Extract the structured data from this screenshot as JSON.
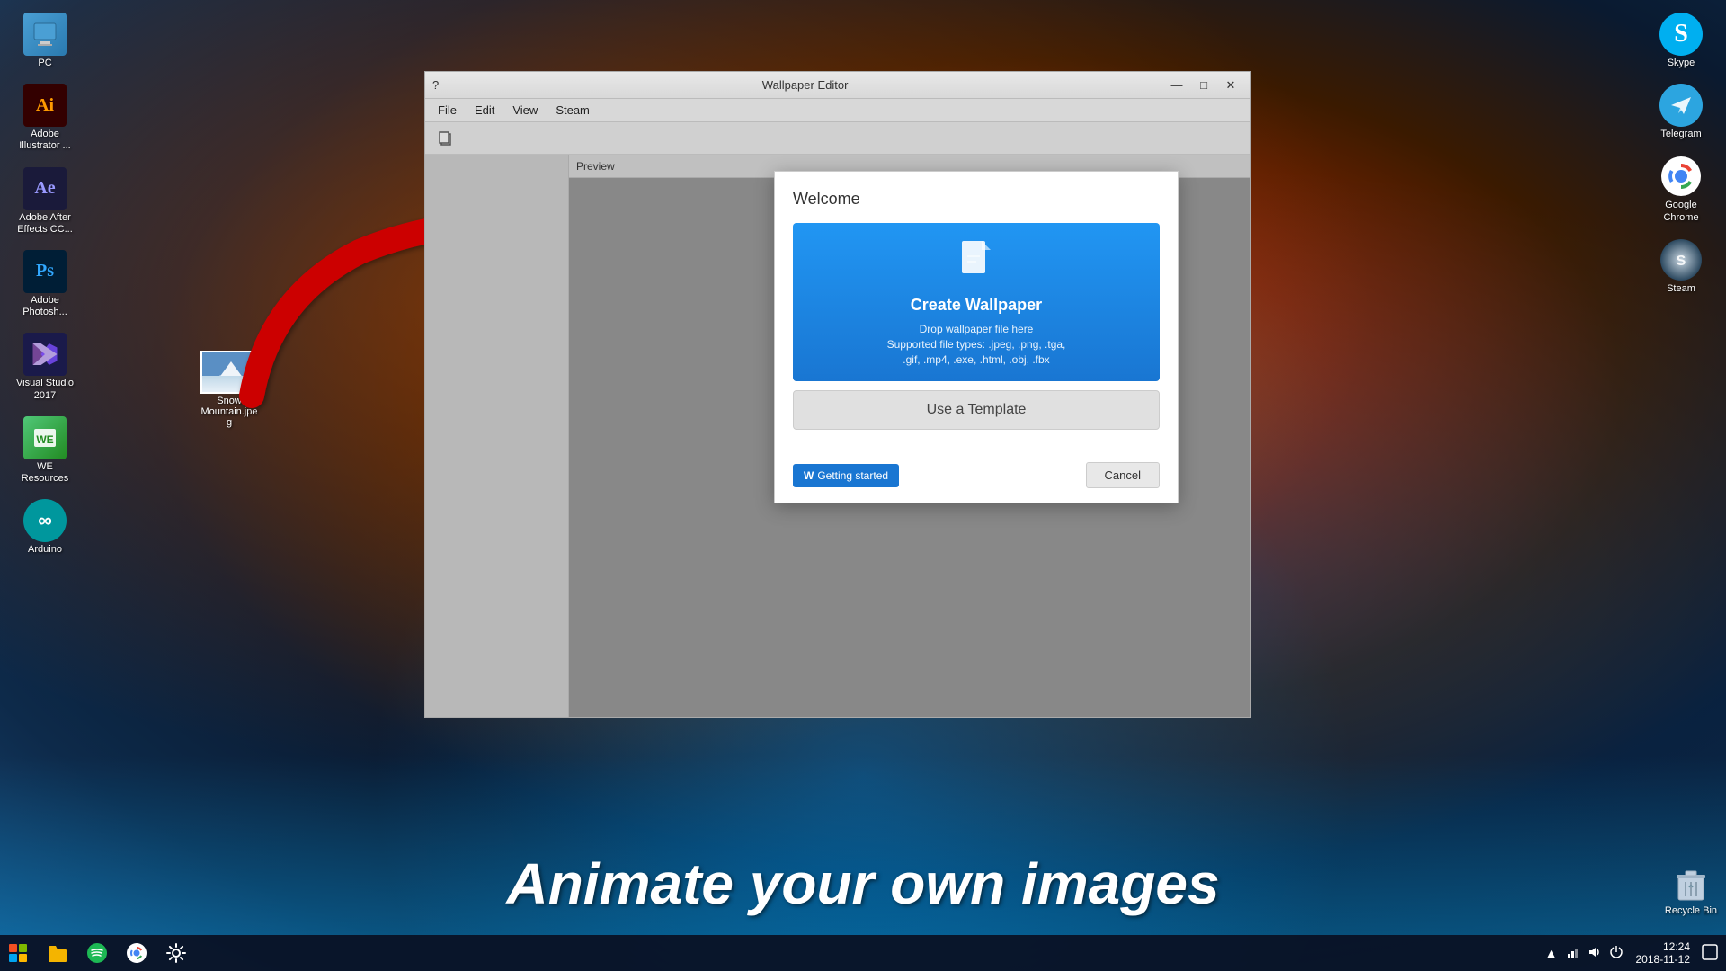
{
  "desktop": {
    "background_description": "space nebula with orange and blue colors"
  },
  "desktop_icons_left": {
    "items": [
      {
        "id": "pc",
        "label": "PC",
        "type": "pc"
      },
      {
        "id": "adobe_illustrator",
        "label": "Adobe Illustrator ...",
        "type": "ai"
      },
      {
        "id": "adobe_after_effects",
        "label": "Adobe After Effects CC...",
        "type": "ae"
      },
      {
        "id": "adobe_photoshop",
        "label": "Adobe Photosh...",
        "type": "ps"
      },
      {
        "id": "visual_studio",
        "label": "Visual Studio 2017",
        "type": "vs"
      },
      {
        "id": "we_resources",
        "label": "WE Resources",
        "type": "we"
      },
      {
        "id": "arduino",
        "label": "Arduino",
        "type": "arduino"
      }
    ]
  },
  "desktop_icons_right": {
    "items": [
      {
        "id": "skype",
        "label": "Skype",
        "type": "skype"
      },
      {
        "id": "telegram",
        "label": "Telegram",
        "type": "telegram"
      },
      {
        "id": "google_chrome",
        "label": "Google Chrome",
        "type": "chrome"
      },
      {
        "id": "steam",
        "label": "Steam",
        "type": "steam"
      }
    ]
  },
  "desktop_file": {
    "label": "Snow Mountain.jpeg",
    "short_label": "Snow\nMountain.jpe\ng"
  },
  "we_window": {
    "title": "Wallpaper Editor",
    "menu_items": [
      "File",
      "Edit",
      "View",
      "Steam"
    ],
    "preview_label": "Preview"
  },
  "welcome_dialog": {
    "title": "Welcome",
    "create_wallpaper": {
      "label": "Create Wallpaper",
      "drop_text": "Drop wallpaper file here\nSupported file types: .jpeg, .png, .tga,\n.gif, .mp4, .exe, .html, .obj, .fbx"
    },
    "use_template_label": "Use a Template",
    "getting_started_label": "Getting started",
    "cancel_label": "Cancel"
  },
  "bottom_overlay_text": "Animate your own images",
  "taskbar": {
    "start_label": "Start",
    "time": "12:24",
    "date": "2018-11-12"
  },
  "recycle_bin": {
    "label": "Recycle Bin"
  }
}
